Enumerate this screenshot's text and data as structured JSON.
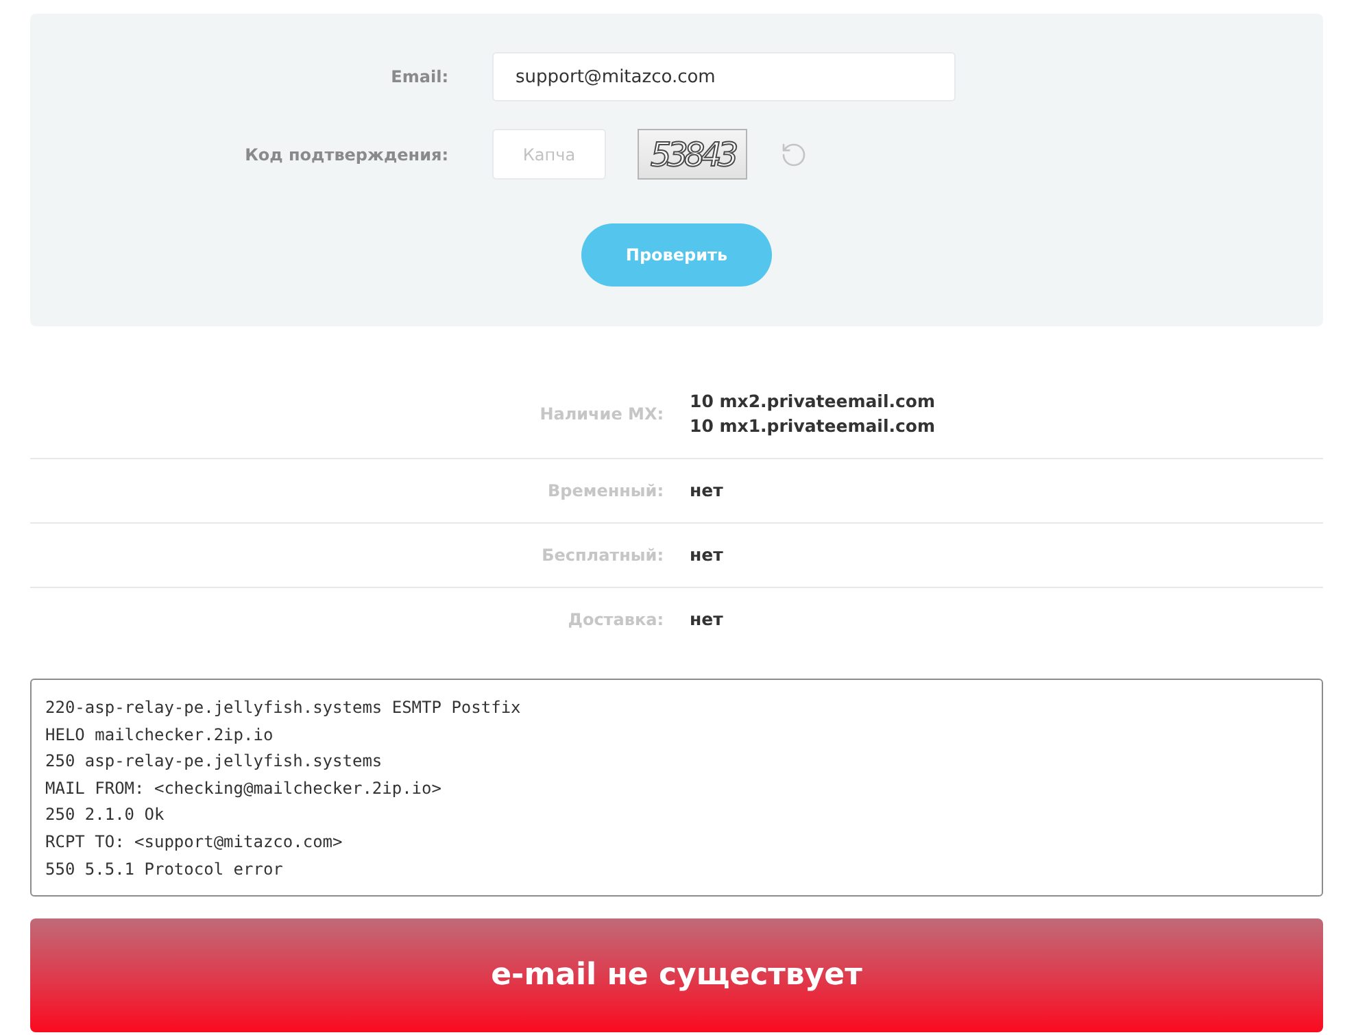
{
  "form": {
    "email": {
      "label": "Email:",
      "value": "support@mitazco.com"
    },
    "captcha": {
      "label": "Код подтверждения:",
      "placeholder": "Капча",
      "code": "53843"
    },
    "submit": "Проверить"
  },
  "results": [
    {
      "label": "Наличие MX:",
      "values": [
        "**10** mx2.privateemail.com",
        "**10** mx1.privateemail.com"
      ]
    },
    {
      "label": "Временный:",
      "values": [
        "нет"
      ]
    },
    {
      "label": "Бесплатный:",
      "values": [
        "нет"
      ]
    },
    {
      "label": "Доставка:",
      "values": [
        "нет"
      ]
    }
  ],
  "log": [
    "220-asp-relay-pe.jellyfish.systems ESMTP Postfix",
    "HELO mailchecker.2ip.io",
    "250 asp-relay-pe.jellyfish.systems",
    "MAIL FROM: <checking@mailchecker.2ip.io>",
    "250 2.1.0 Ok",
    "RCPT TO: <support@mitazco.com>",
    "550 5.5.1 Protocol error"
  ],
  "verdict": {
    "kind": "error",
    "text": "e-mail не существует"
  }
}
